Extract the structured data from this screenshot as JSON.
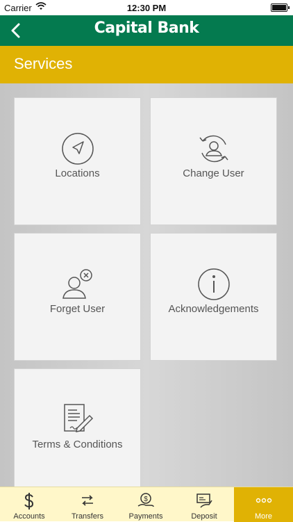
{
  "status": {
    "carrier": "Carrier",
    "time": "12:30 PM"
  },
  "header": {
    "logo": "Capital Bank"
  },
  "page": {
    "title": "Services"
  },
  "tiles": [
    {
      "label": "Locations",
      "icon": "location-arrow-icon"
    },
    {
      "label": "Change User",
      "icon": "change-user-icon"
    },
    {
      "label": "Forget User",
      "icon": "forget-user-icon"
    },
    {
      "label": "Acknowledgements",
      "icon": "info-icon"
    },
    {
      "label": "Terms & Conditions",
      "icon": "document-icon"
    }
  ],
  "tabs": [
    {
      "label": "Accounts",
      "icon": "dollar-icon"
    },
    {
      "label": "Transfers",
      "icon": "transfer-icon"
    },
    {
      "label": "Payments",
      "icon": "payment-icon"
    },
    {
      "label": "Deposit",
      "icon": "check-deposit-icon"
    },
    {
      "label": "More",
      "icon": "more-icon",
      "active": true
    }
  ],
  "colors": {
    "brand_green": "#047a4f",
    "accent_gold": "#e0b204",
    "tabbar_bg": "#fff7c9"
  }
}
